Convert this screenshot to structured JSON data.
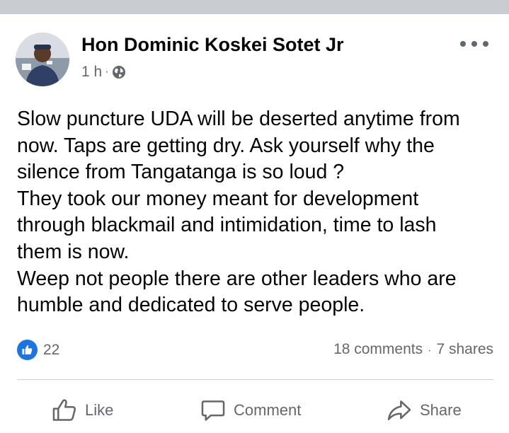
{
  "post": {
    "author": "Hon Dominic Koskei Sotet Jr",
    "time": "1 h",
    "meta_separator": "·",
    "body_lines": [
      "Slow puncture UDA will be deserted anytime from",
      "now. Taps are getting dry. Ask yourself why the",
      "silence from Tangatanga is so loud ?",
      "They took our money meant for development",
      "through blackmail and intimidation, time to lash",
      "them is now.",
      "Weep not people there are other leaders who are",
      "humble and dedicated to serve people."
    ]
  },
  "reactions": {
    "like_count": "22",
    "comments": "18 comments",
    "separator": "·",
    "shares": "7 shares"
  },
  "actions": {
    "like": "Like",
    "comment": "Comment",
    "share": "Share"
  },
  "icons": {
    "privacy": "globe-icon",
    "menu": "more-options-icon",
    "reaction": "thumbs-up-icon",
    "like_action": "thumbs-up-outline-icon",
    "comment_action": "speech-bubble-icon",
    "share_action": "share-arrow-icon"
  },
  "colors": {
    "accent": "#1b74e4",
    "secondary_text": "#65676b",
    "primary_text": "#050505",
    "divider": "#ced0d4"
  }
}
